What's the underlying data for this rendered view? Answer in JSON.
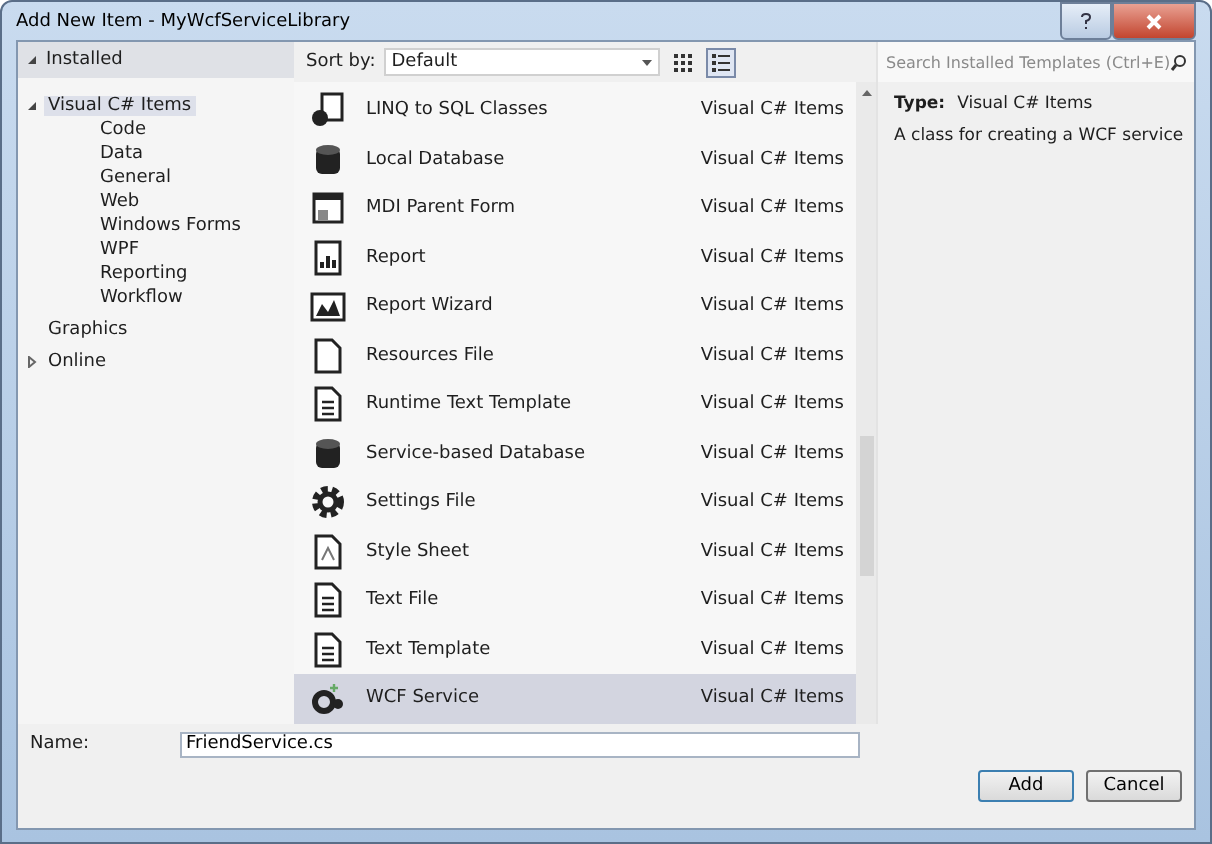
{
  "window": {
    "title": "Add New Item - MyWcfServiceLibrary"
  },
  "tree": [
    {
      "label": "Installed",
      "expanded": true,
      "selected": false,
      "children": [
        {
          "label": "Visual C# Items",
          "expanded": true,
          "selected": true,
          "children": [
            {
              "label": "Code"
            },
            {
              "label": "Data"
            },
            {
              "label": "General"
            },
            {
              "label": "Web"
            },
            {
              "label": "Windows Forms"
            },
            {
              "label": "WPF"
            },
            {
              "label": "Reporting"
            },
            {
              "label": "Workflow"
            }
          ]
        },
        {
          "label": "Graphics"
        }
      ]
    },
    {
      "label": "Online",
      "expanded": false,
      "selected": false
    }
  ],
  "toolbar": {
    "sort_label": "Sort by:",
    "sort_value": "Default",
    "view_buttons": [
      {
        "selected": false
      },
      {
        "selected": true
      }
    ]
  },
  "search": {
    "placeholder": "Search Installed Templates (Ctrl+E)"
  },
  "templates": [
    {
      "name": "LINQ to SQL Classes",
      "category": "Visual C# Items",
      "selected": false
    },
    {
      "name": "Local Database",
      "category": "Visual C# Items",
      "selected": false
    },
    {
      "name": "MDI Parent Form",
      "category": "Visual C# Items",
      "selected": false
    },
    {
      "name": "Report",
      "category": "Visual C# Items",
      "selected": false
    },
    {
      "name": "Report Wizard",
      "category": "Visual C# Items",
      "selected": false
    },
    {
      "name": "Resources File",
      "category": "Visual C# Items",
      "selected": false
    },
    {
      "name": "Runtime Text Template",
      "category": "Visual C# Items",
      "selected": false
    },
    {
      "name": "Service-based Database",
      "category": "Visual C# Items",
      "selected": false
    },
    {
      "name": "Settings File",
      "category": "Visual C# Items",
      "selected": false
    },
    {
      "name": "Style Sheet",
      "category": "Visual C# Items",
      "selected": false
    },
    {
      "name": "Text File",
      "category": "Visual C# Items",
      "selected": false
    },
    {
      "name": "Text Template",
      "category": "Visual C# Items",
      "selected": false
    },
    {
      "name": "WCF Service",
      "category": "Visual C# Items",
      "selected": true
    }
  ],
  "details": {
    "type_label": "Type:",
    "type_value": "Visual C# Items",
    "description": "A class for creating a WCF service"
  },
  "name_field": {
    "label": "Name:",
    "value": "FriendService.cs"
  },
  "buttons": [
    "Add",
    "Cancel"
  ]
}
